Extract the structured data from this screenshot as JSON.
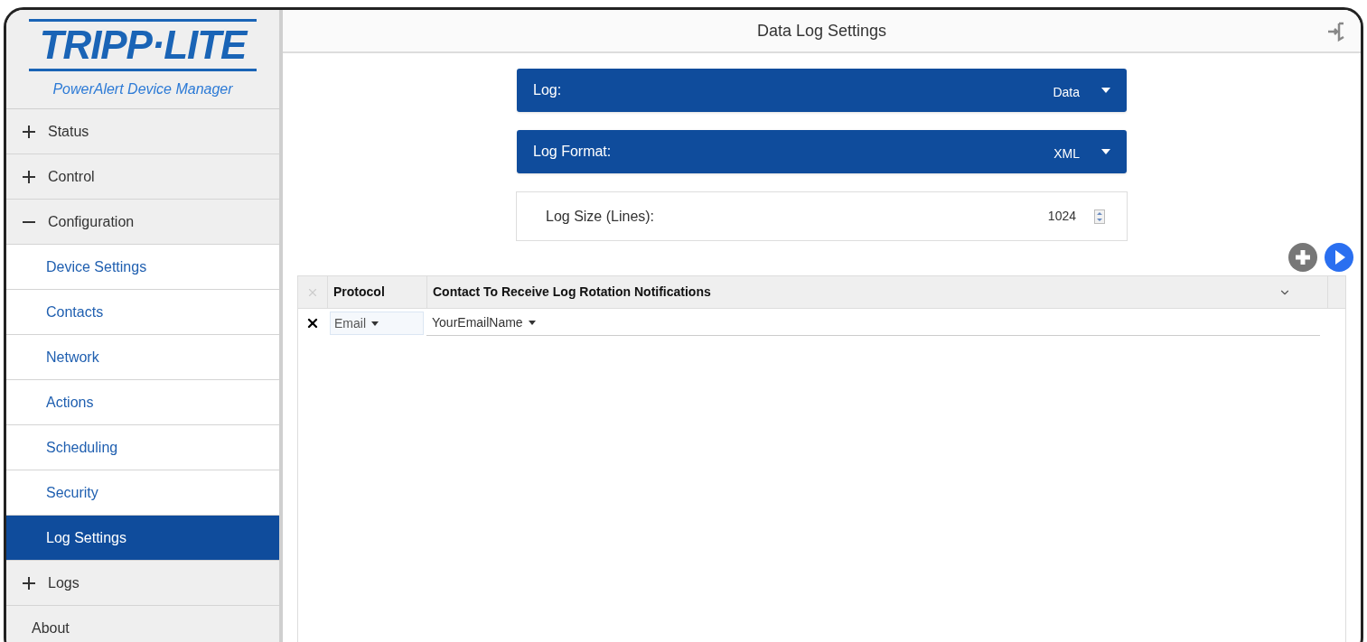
{
  "sidebar": {
    "logo": "TRIPP·LITE",
    "subtitle": "PowerAlert Device Manager",
    "items": [
      {
        "label": "Status",
        "kind": "group",
        "expanded": false,
        "selected": false
      },
      {
        "label": "Control",
        "kind": "group",
        "expanded": false,
        "selected": false
      },
      {
        "label": "Configuration",
        "kind": "group",
        "expanded": true,
        "selected": false
      },
      {
        "label": "Device Settings",
        "kind": "sub",
        "selected": false
      },
      {
        "label": "Contacts",
        "kind": "sub",
        "selected": false
      },
      {
        "label": "Network",
        "kind": "sub",
        "selected": false
      },
      {
        "label": "Actions",
        "kind": "sub",
        "selected": false
      },
      {
        "label": "Scheduling",
        "kind": "sub",
        "selected": false
      },
      {
        "label": "Security",
        "kind": "sub",
        "selected": false
      },
      {
        "label": "Log Settings",
        "kind": "sub",
        "selected": true
      },
      {
        "label": "Logs",
        "kind": "group",
        "expanded": false,
        "selected": false
      },
      {
        "label": "About",
        "kind": "plain",
        "selected": false
      }
    ]
  },
  "header": {
    "title": "Data Log Settings"
  },
  "settings": [
    {
      "kind": "dropdown",
      "label": "Log:",
      "value": "Data"
    },
    {
      "kind": "dropdown",
      "label": "Log Format:",
      "value": "XML"
    },
    {
      "kind": "spinner",
      "label": "Log Size (Lines):",
      "value": "1024"
    }
  ],
  "table": {
    "columns": [
      "Protocol",
      "Contact To Receive Log Rotation Notifications"
    ],
    "rows": [
      {
        "protocol": "Email",
        "contact": "YourEmailName"
      }
    ]
  }
}
